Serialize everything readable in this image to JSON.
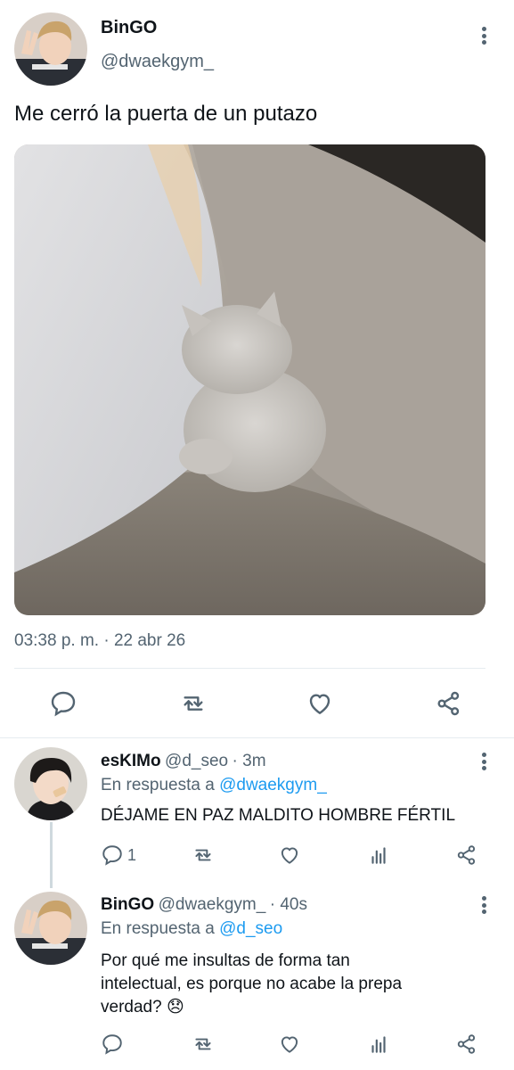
{
  "main_tweet": {
    "author_name": "BinGO",
    "author_handle": "@dwaekgym_",
    "text": "Me cerró la puerta de un putazo",
    "timestamp": "03:38 p. m. · 22 abr 26",
    "avatar_icon": "avatar-photo",
    "actions": [
      {
        "name": "reply-icon"
      },
      {
        "name": "retweet-icon"
      },
      {
        "name": "like-icon"
      },
      {
        "name": "share-icon"
      }
    ]
  },
  "replies": [
    {
      "author_name": "esKIMo",
      "author_handle": "@d_seo",
      "time": "· 3m",
      "reply_to_label": "En respuesta a",
      "reply_to_handle": "@dwaekgym_",
      "text": "DÉJAME EN PAZ MALDITO HOMBRE FÉRTIL",
      "reply_count": "1"
    },
    {
      "author_name": "BinGO",
      "author_handle": "@dwaekgym_",
      "time": "· 40s",
      "reply_to_label": "En respuesta a",
      "reply_to_handle": "@d_seo",
      "text_line1": "Por qué me insultas de forma tan",
      "text_line2": "intelectual, es porque no acabe la prepa",
      "text_line3": "verdad?",
      "emoji": "😞"
    }
  ],
  "colors": {
    "text_primary": "#0f1419",
    "text_secondary": "#536471",
    "link": "#1d9bf0",
    "divider": "#e6ecf0"
  }
}
